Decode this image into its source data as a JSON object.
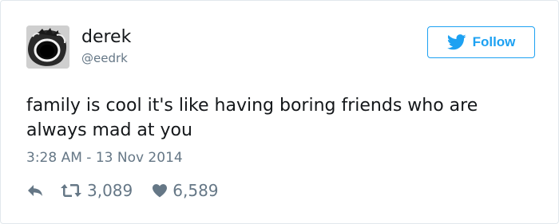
{
  "user": {
    "display_name": "derek",
    "handle": "@eedrk",
    "avatar": "screaming-face-avatar"
  },
  "follow_button": {
    "label": "Follow",
    "icon": "twitter-bird-icon",
    "color": "#1da1f2"
  },
  "tweet": {
    "text": "family is cool it's like having boring friends who are always mad at you",
    "timestamp": "3:28 AM - 13 Nov 2014"
  },
  "actions": {
    "reply_icon": "reply-icon",
    "retweet_icon": "retweet-icon",
    "retweet_count": "3,089",
    "like_icon": "heart-icon",
    "like_count": "6,589"
  },
  "colors": {
    "text": "#14171a",
    "muted": "#657786",
    "border": "#e1e8ed"
  }
}
